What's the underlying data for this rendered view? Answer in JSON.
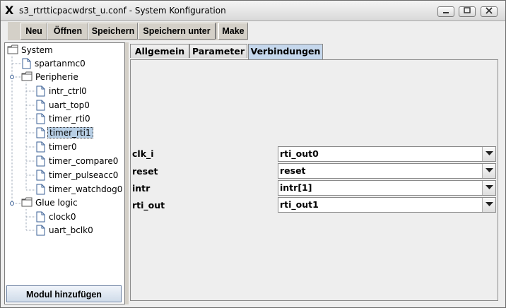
{
  "window": {
    "title": "s3_rtrtticpacwdrst_u.conf - System Konfiguration",
    "app_icon": "x-icon",
    "buttons": [
      "minimize",
      "maximize",
      "close"
    ]
  },
  "toolbar": {
    "items": [
      "Neu",
      "Öffnen",
      "Speichern",
      "Speichern unter",
      "Make"
    ]
  },
  "tree": {
    "root": "System",
    "nodes": [
      {
        "label": "System",
        "type": "folder"
      },
      {
        "label": "spartanmc0",
        "type": "file"
      },
      {
        "label": "Peripherie",
        "type": "folder"
      },
      {
        "label": "intr_ctrl0",
        "type": "file"
      },
      {
        "label": "uart_top0",
        "type": "file"
      },
      {
        "label": "timer_rti0",
        "type": "file"
      },
      {
        "label": "timer_rti1",
        "type": "file",
        "selected": true
      },
      {
        "label": "timer0",
        "type": "file"
      },
      {
        "label": "timer_compare0",
        "type": "file"
      },
      {
        "label": "timer_pulseacc0",
        "type": "file"
      },
      {
        "label": "timer_watchdog0",
        "type": "file"
      },
      {
        "label": "Glue logic",
        "type": "folder"
      },
      {
        "label": "clock0",
        "type": "file"
      },
      {
        "label": "uart_bclk0",
        "type": "file"
      }
    ]
  },
  "add_module_label": "Modul hinzufügen",
  "tabs": {
    "items": [
      "Allgemein",
      "Parameter",
      "Verbindungen"
    ],
    "active": "Verbindungen"
  },
  "connections": [
    {
      "name": "clk_i",
      "value": "rti_out0"
    },
    {
      "name": "reset",
      "value": "reset"
    },
    {
      "name": "intr",
      "value": "intr[1]"
    },
    {
      "name": "rti_out",
      "value": "rti_out1"
    }
  ],
  "colors": {
    "selection": "#b8cfe5",
    "active_tab": "#c5d7ec"
  }
}
